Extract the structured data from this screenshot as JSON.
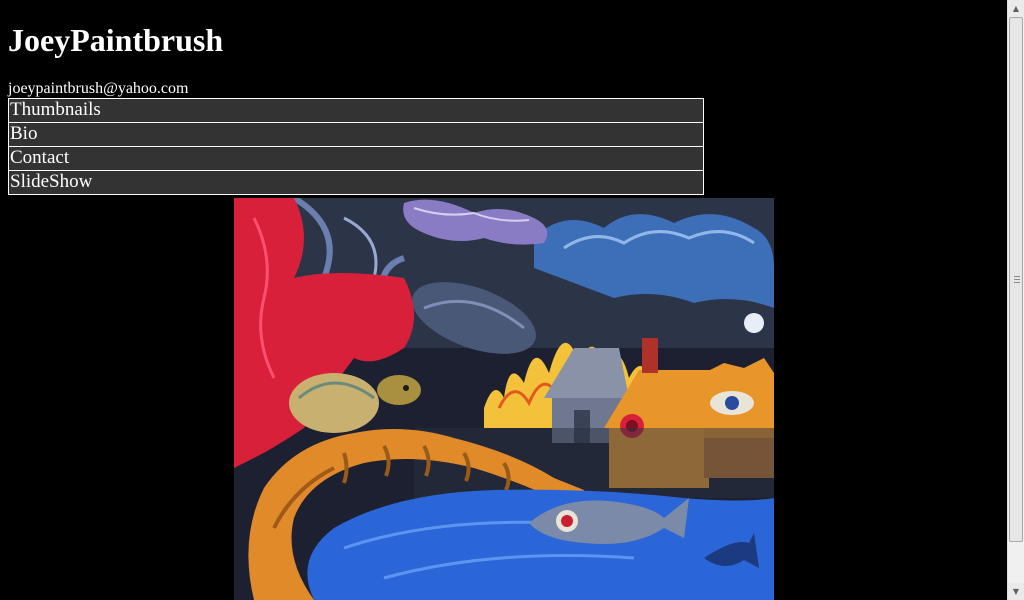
{
  "site": {
    "title": "JoeyPaintbrush",
    "email": "joeypaintbrush@yahoo.com"
  },
  "nav": {
    "items": [
      {
        "label": "Thumbnails"
      },
      {
        "label": "Bio"
      },
      {
        "label": "Contact"
      },
      {
        "label": "SlideShow"
      }
    ]
  },
  "painting": {
    "subject": "surreal landscape painting with houses, fire, clouds, fish and lake"
  },
  "colors": {
    "background": "#000000",
    "nav_background": "#333333",
    "nav_border": "#ffffff",
    "text": "#ffffff"
  },
  "icons": {
    "scroll_up": "up-arrow-icon",
    "scroll_down": "down-arrow-icon"
  }
}
